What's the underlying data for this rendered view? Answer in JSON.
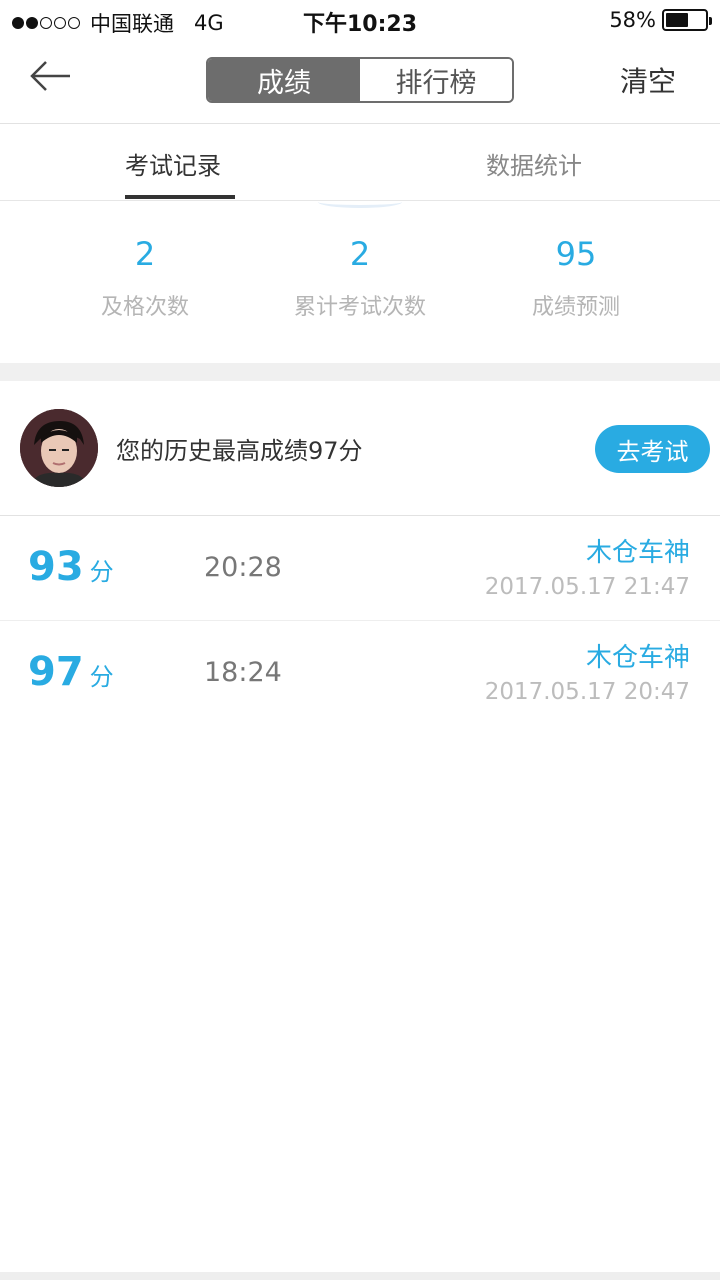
{
  "status_bar": {
    "carrier": "中国联通",
    "network": "4G",
    "time": "下午10:23",
    "battery": "58%",
    "battery_level": 0.58,
    "signal_strength": 2,
    "signal_max": 5
  },
  "nav": {
    "segments": [
      "成绩",
      "排行榜"
    ],
    "active_segment": 0,
    "clear_label": "清空"
  },
  "tabs": {
    "items": [
      "考试记录",
      "数据统计"
    ],
    "active": 0
  },
  "stats": [
    {
      "value": "2",
      "label": "及格次数"
    },
    {
      "value": "2",
      "label": "累计考试次数"
    },
    {
      "value": "95",
      "label": "成绩预测"
    }
  ],
  "best": {
    "text": "您的历史最高成绩97分",
    "button": "去考试"
  },
  "records": [
    {
      "score": "93",
      "unit": "分",
      "duration": "20:28",
      "name": "木仓车神",
      "date": "2017.05.17 21:47"
    },
    {
      "score": "97",
      "unit": "分",
      "duration": "18:24",
      "name": "木仓车神",
      "date": "2017.05.17 20:47"
    }
  ],
  "colors": {
    "accent": "#29abe2",
    "segment_active": "#6d6d6d",
    "muted_text": "#b5b5b5"
  }
}
